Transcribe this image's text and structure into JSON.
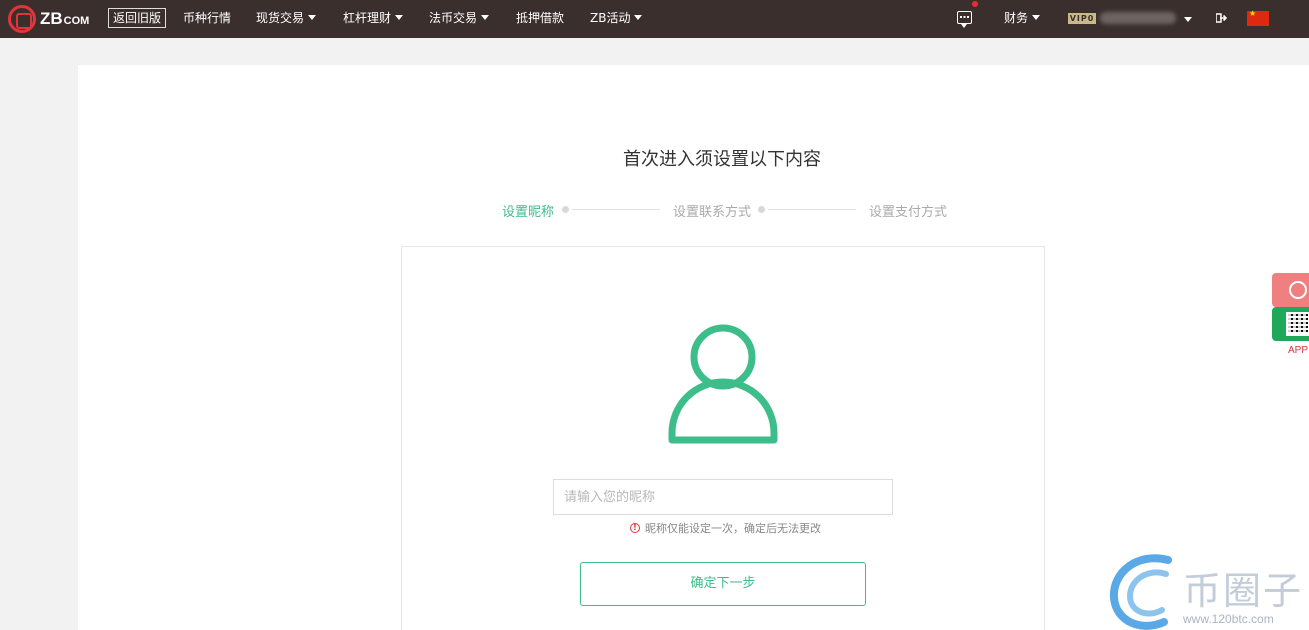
{
  "header": {
    "logo_text": "ZB",
    "logo_suffix": "COM",
    "old_version": "返回旧版",
    "nav": [
      {
        "label": "币种行情",
        "dropdown": false
      },
      {
        "label": "现货交易",
        "dropdown": true
      },
      {
        "label": "杠杆理财",
        "dropdown": true
      },
      {
        "label": "法币交易",
        "dropdown": true
      },
      {
        "label": "抵押借款",
        "dropdown": false
      },
      {
        "label": "ZB活动",
        "dropdown": true
      }
    ],
    "finance": "财务",
    "vip_badge": "VIP0"
  },
  "main": {
    "heading": "首次进入须设置以下内容",
    "steps": [
      {
        "label": "设置昵称",
        "active": true
      },
      {
        "label": "设置联系方式",
        "active": false
      },
      {
        "label": "设置支付方式",
        "active": false
      }
    ],
    "nickname_placeholder": "请输入您的昵称",
    "hint": "昵称仅能设定一次，确定后无法更改",
    "next_button": "确定下一步"
  },
  "float": {
    "app_label": "APP"
  },
  "watermark": {
    "title": "币圈子",
    "url": "www.120btc.com"
  },
  "colors": {
    "header_bg": "#3a2f2c",
    "accent_green": "#3dbd8a",
    "brand_red": "#e0353b"
  }
}
